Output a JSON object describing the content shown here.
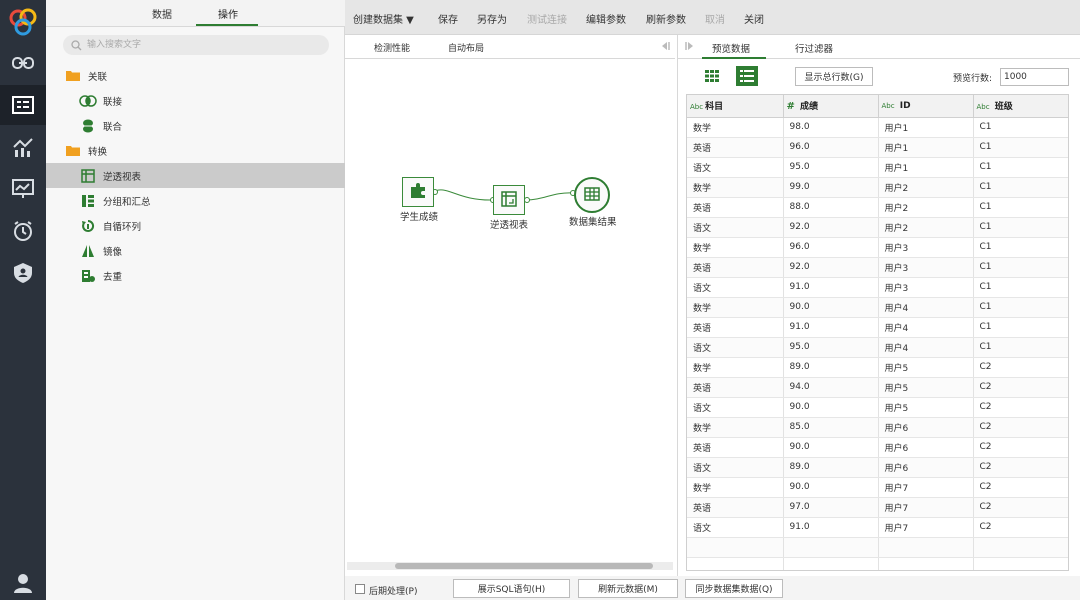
{
  "left_panel": {
    "tabs": [
      "数据",
      "操作"
    ],
    "search_placeholder": "输入搜索文字",
    "tree": [
      {
        "label": "关联",
        "icon": "folder-icon"
      },
      {
        "label": "联接",
        "icon": "join-icon"
      },
      {
        "label": "联合",
        "icon": "union-icon"
      },
      {
        "label": "转换",
        "icon": "folder-icon"
      },
      {
        "label": "逆透视表",
        "icon": "unpivot-icon"
      },
      {
        "label": "分组和汇总",
        "icon": "group-icon"
      },
      {
        "label": "自循环列",
        "icon": "self-loop-icon"
      },
      {
        "label": "镜像",
        "icon": "mirror-icon"
      },
      {
        "label": "去重",
        "icon": "dedupe-icon"
      }
    ]
  },
  "toolbar": {
    "create_dataset": "创建数据集 ▼",
    "save": "保存",
    "save_as": "另存为",
    "test_connection": "测试连接",
    "edit_params": "编辑参数",
    "refresh_params": "刷新参数",
    "cancel": "取消",
    "close": "关闭"
  },
  "canvas": {
    "tabs": [
      "检测性能",
      "自动布局"
    ],
    "nodes": [
      "学生成绩",
      "逆透视表",
      "数据集结果"
    ]
  },
  "preview": {
    "tabs": [
      "预览数据",
      "行过滤器"
    ],
    "show_total_button": "显示总行数(G)",
    "rows_label": "预览行数:",
    "rows_value": "1000",
    "columns": [
      {
        "type": "Abc",
        "name": "科目"
      },
      {
        "type": "#",
        "name": "成绩"
      },
      {
        "type": "Abc",
        "name": "ID"
      },
      {
        "type": "Abc",
        "name": "班级"
      }
    ],
    "rows": [
      [
        "数学",
        "98.0",
        "用户1",
        "C1"
      ],
      [
        "英语",
        "96.0",
        "用户1",
        "C1"
      ],
      [
        "语文",
        "95.0",
        "用户1",
        "C1"
      ],
      [
        "数学",
        "99.0",
        "用户2",
        "C1"
      ],
      [
        "英语",
        "88.0",
        "用户2",
        "C1"
      ],
      [
        "语文",
        "92.0",
        "用户2",
        "C1"
      ],
      [
        "数学",
        "96.0",
        "用户3",
        "C1"
      ],
      [
        "英语",
        "92.0",
        "用户3",
        "C1"
      ],
      [
        "语文",
        "91.0",
        "用户3",
        "C1"
      ],
      [
        "数学",
        "90.0",
        "用户4",
        "C1"
      ],
      [
        "英语",
        "91.0",
        "用户4",
        "C1"
      ],
      [
        "语文",
        "95.0",
        "用户4",
        "C1"
      ],
      [
        "数学",
        "89.0",
        "用户5",
        "C2"
      ],
      [
        "英语",
        "94.0",
        "用户5",
        "C2"
      ],
      [
        "语文",
        "90.0",
        "用户5",
        "C2"
      ],
      [
        "数学",
        "85.0",
        "用户6",
        "C2"
      ],
      [
        "英语",
        "90.0",
        "用户6",
        "C2"
      ],
      [
        "语文",
        "89.0",
        "用户6",
        "C2"
      ],
      [
        "数学",
        "90.0",
        "用户7",
        "C2"
      ],
      [
        "英语",
        "97.0",
        "用户7",
        "C2"
      ],
      [
        "语文",
        "91.0",
        "用户7",
        "C2"
      ],
      [
        "",
        "",
        "",
        ""
      ],
      [
        "",
        "",
        "",
        ""
      ]
    ]
  },
  "bottom": {
    "post_process": "后期处理(P)",
    "show_sql": "展示SQL语句(H)",
    "refresh_meta": "刷新元数据(M)",
    "sync_dataset": "同步数据集数据(Q)"
  },
  "colors": {
    "accent": "#2e7d32",
    "rail": "#2b323c",
    "folder": "#f0a020"
  }
}
